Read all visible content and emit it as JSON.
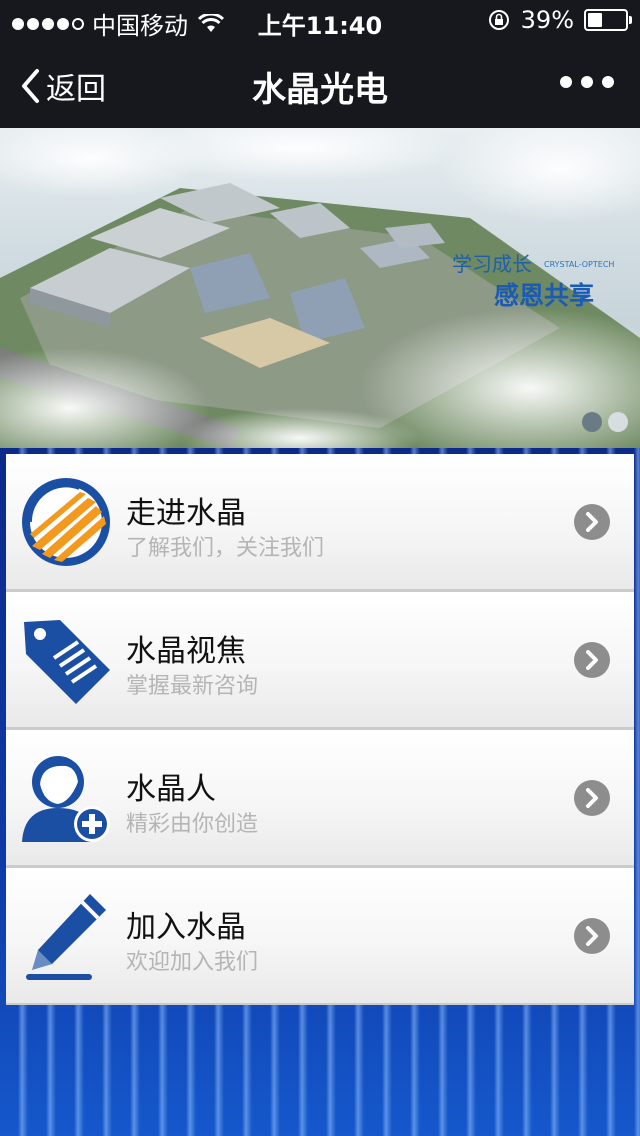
{
  "status_bar": {
    "carrier": "中国移动",
    "time": "上午11:40",
    "battery_percent": "39%",
    "battery_level": 0.39
  },
  "nav": {
    "back_label": "返回",
    "title": "水晶光电"
  },
  "banner": {
    "slogan_line1": "学习成长",
    "slogan_tag": "CRYSTAL-OPTECH",
    "slogan_line2": "感恩共享",
    "pager_count": 2,
    "pager_active": 0
  },
  "menu": [
    {
      "title": "走进水晶",
      "subtitle": "了解我们，关注我们",
      "icon": "company-logo-icon"
    },
    {
      "title": "水晶视焦",
      "subtitle": "掌握最新咨询",
      "icon": "tag-icon"
    },
    {
      "title": "水晶人",
      "subtitle": "精彩由你创造",
      "icon": "add-user-icon"
    },
    {
      "title": "加入水晶",
      "subtitle": "欢迎加入我们",
      "icon": "pencil-icon"
    }
  ],
  "colors": {
    "nav_bg": "#16181d",
    "icon_blue": "#1a4fa3",
    "accent_orange": "#f39a1e"
  }
}
